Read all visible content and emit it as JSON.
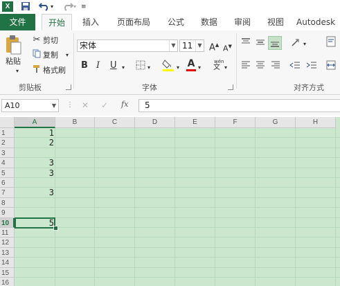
{
  "titlebar": {
    "logo": "X",
    "save_icon": "floppy-save-icon",
    "undo_icon": "undo-icon",
    "redo_icon": "redo-icon",
    "customize_icon": "customize-qat-icon"
  },
  "tabs": [
    {
      "label": "文件"
    },
    {
      "label": "开始"
    },
    {
      "label": "插入"
    },
    {
      "label": "页面布局"
    },
    {
      "label": "公式"
    },
    {
      "label": "数据"
    },
    {
      "label": "审阅"
    },
    {
      "label": "视图"
    },
    {
      "label": "Autodesk"
    }
  ],
  "ribbon": {
    "clipboard": {
      "paste": "粘贴",
      "cut": "剪切",
      "copy": "复制",
      "format_painter": "格式刷",
      "group_label": "剪贴板"
    },
    "font": {
      "font_name": "宋体",
      "font_size": "11",
      "grow": "A",
      "shrink": "A",
      "bold": "B",
      "italic": "I",
      "underline": "U",
      "font_color_letter": "A",
      "phonetic": "文",
      "group_label": "字体",
      "highlight_color": "#ffff00",
      "font_color": "#e00000"
    },
    "alignment": {
      "group_label": "对齐方式"
    }
  },
  "formula_bar": {
    "name_box": "A10",
    "fx_label": "fx",
    "value": "5"
  },
  "sheet": {
    "columns": [
      "A",
      "B",
      "C",
      "D",
      "E",
      "F",
      "G",
      "H"
    ],
    "rows": [
      "1",
      "2",
      "3",
      "4",
      "5",
      "6",
      "7",
      "8",
      "9",
      "10",
      "11",
      "12",
      "13",
      "14",
      "15",
      "16"
    ],
    "cells_A": [
      "1",
      "2",
      "",
      "3",
      "3",
      "",
      "3",
      "",
      "",
      "5",
      "",
      "",
      "",
      "",
      "",
      ""
    ],
    "selected_cell": "A10",
    "colors": {
      "accent": "#217346",
      "sheet_bg": "#cbe8cf"
    }
  }
}
